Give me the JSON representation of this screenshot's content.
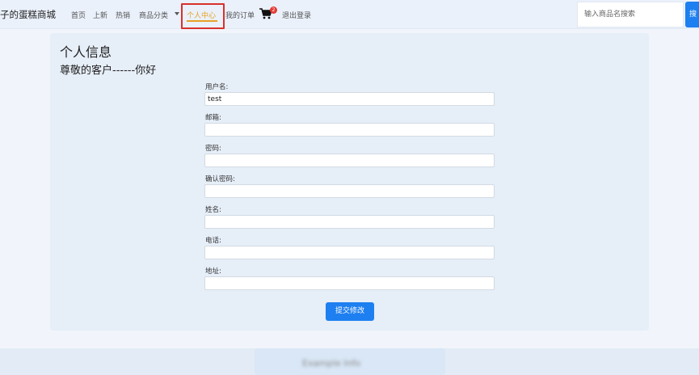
{
  "header": {
    "brand": "子的蛋糕商城",
    "nav": [
      "首页",
      "上新",
      "热销",
      "商品分类",
      "个人中心",
      "我的订单",
      "退出登录"
    ],
    "cart_badge": "2",
    "search_placeholder": "输入商品名搜索",
    "search_button_label": "搜"
  },
  "profile": {
    "title": "个人信息",
    "greeting": "尊敬的客户------你好",
    "fields": [
      {
        "label": "用户名:",
        "value": "test"
      },
      {
        "label": "邮箱:",
        "value": ""
      },
      {
        "label": "密码:",
        "value": ""
      },
      {
        "label": "确认密码:",
        "value": ""
      },
      {
        "label": "姓名:",
        "value": ""
      },
      {
        "label": "电话:",
        "value": ""
      },
      {
        "label": "地址:",
        "value": ""
      }
    ],
    "submit_label": "提交修改"
  },
  "footer": {
    "text": "Example Info"
  },
  "colors": {
    "accent": "#1e7ff0",
    "active_nav": "#e8a126",
    "highlight_box": "#d9302c",
    "badge": "#e53935"
  }
}
